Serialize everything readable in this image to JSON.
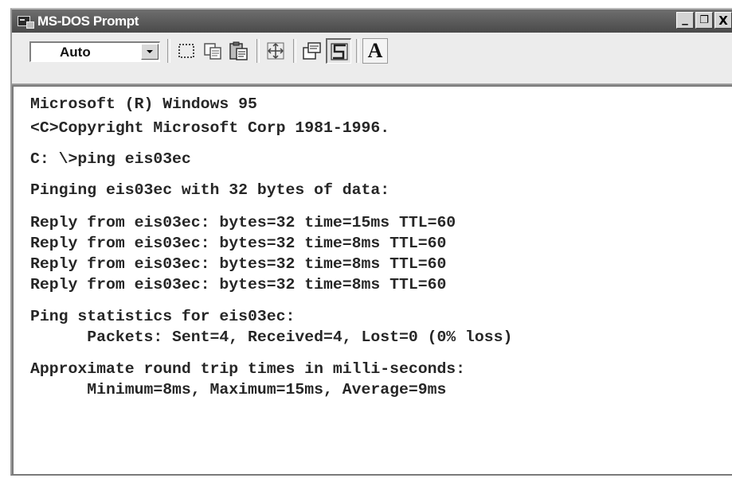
{
  "window": {
    "title": "MS-DOS Prompt",
    "buttons": {
      "minimize": "_",
      "restore": "❐",
      "close": "X"
    }
  },
  "toolbar": {
    "font_size_value": "Auto",
    "buttons": [
      "mark-icon",
      "copy-icon",
      "paste-icon",
      "full-screen-icon",
      "properties-icon",
      "background-icon",
      "font-icon"
    ],
    "font_button_label": "A"
  },
  "console": {
    "lines": [
      "Microsoft (R) Windows 95",
      "<C>Copyright Microsoft Corp 1981-1996.",
      "C: \\>ping eis03ec",
      "Pinging eis03ec with 32 bytes of data:",
      "Reply from eis03ec: bytes=32 time=15ms TTL=60",
      "Reply from eis03ec: bytes=32 time=8ms TTL=60",
      "Reply from eis03ec: bytes=32 time=8ms TTL=60",
      "Reply from eis03ec: bytes=32 time=8ms TTL=60",
      "Ping statistics for eis03ec:",
      "      Packets: Sent=4, Received=4, Lost=0 (0% loss)",
      "Approximate round trip times in milli-seconds:",
      "      Minimum=8ms, Maximum=15ms, Average=9ms"
    ]
  }
}
